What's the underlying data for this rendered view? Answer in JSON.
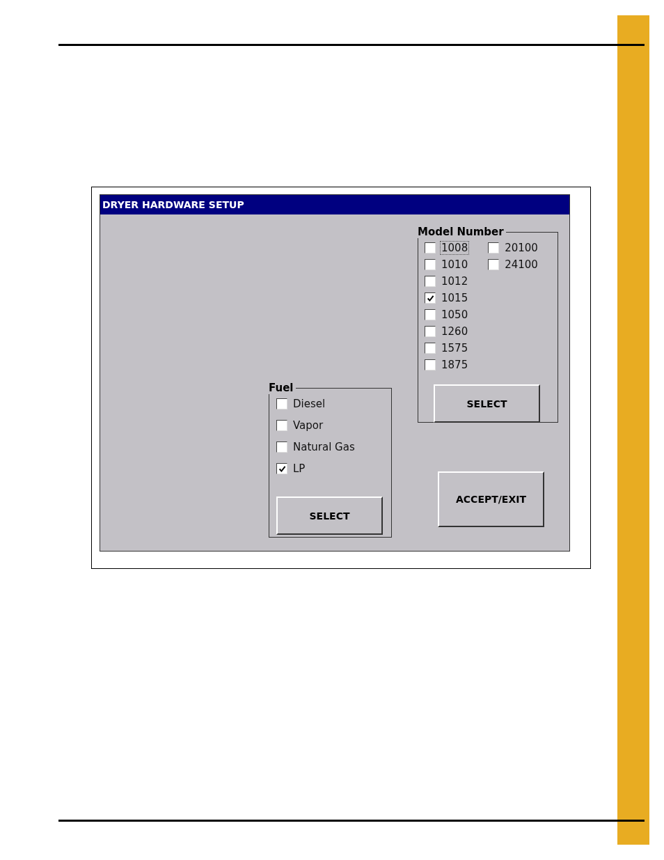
{
  "window": {
    "title": "DRYER HARDWARE SETUP"
  },
  "model_number": {
    "label": "Model Number",
    "columns": [
      [
        {
          "label": "1008",
          "checked": false,
          "focused": true
        },
        {
          "label": "1010",
          "checked": false,
          "focused": false
        },
        {
          "label": "1012",
          "checked": false,
          "focused": false
        },
        {
          "label": "1015",
          "checked": true,
          "focused": false
        },
        {
          "label": "1050",
          "checked": false,
          "focused": false
        },
        {
          "label": "1260",
          "checked": false,
          "focused": false
        },
        {
          "label": "1575",
          "checked": false,
          "focused": false
        },
        {
          "label": "1875",
          "checked": false,
          "focused": false
        }
      ],
      [
        {
          "label": "20100",
          "checked": false,
          "focused": false
        },
        {
          "label": "24100",
          "checked": false,
          "focused": false
        }
      ]
    ],
    "button": "SELECT"
  },
  "fuel": {
    "label": "Fuel",
    "options": [
      {
        "label": "Diesel",
        "checked": false
      },
      {
        "label": "Vapor",
        "checked": false
      },
      {
        "label": "Natural Gas",
        "checked": false
      },
      {
        "label": "LP",
        "checked": true
      }
    ],
    "button": "SELECT"
  },
  "accept_button": "ACCEPT/EXIT"
}
